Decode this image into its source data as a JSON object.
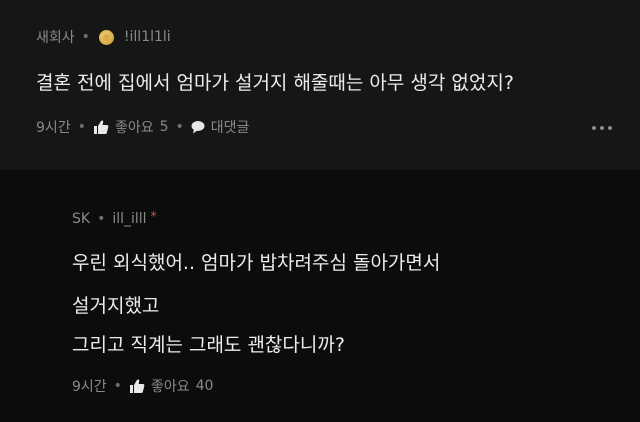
{
  "post": {
    "author": "새회사",
    "nickname": "!ill1l1li",
    "text": "결혼 전에 집에서 엄마가 설거지 해줄때는 아무 생각 없었지?",
    "time": "9시간",
    "like_label": "좋아요",
    "like_count": "5",
    "comment_label": "대댓글"
  },
  "reply": {
    "author": "SK",
    "nickname": "ill_illl",
    "marker": "*",
    "lines": [
      "우린 외식했어.. 엄마가 밥차려주심 돌아가면서",
      "설거지했고",
      "그리고 직계는 그래도 괜찮다니까?"
    ],
    "time": "9시간",
    "like_label": "좋아요",
    "like_count": "40"
  },
  "icons": {
    "badge": "gold-coin-icon",
    "like": "thumbs-up-icon",
    "comment": "speech-bubble-icon",
    "more": "more-dots-icon"
  },
  "colors": {
    "background_post": "#161616",
    "background_reply": "#0c0c0c",
    "text_primary": "#ececec",
    "text_secondary": "#8a8a8a",
    "accent_star": "#d9564b",
    "badge_gold": "#d9ab48"
  }
}
